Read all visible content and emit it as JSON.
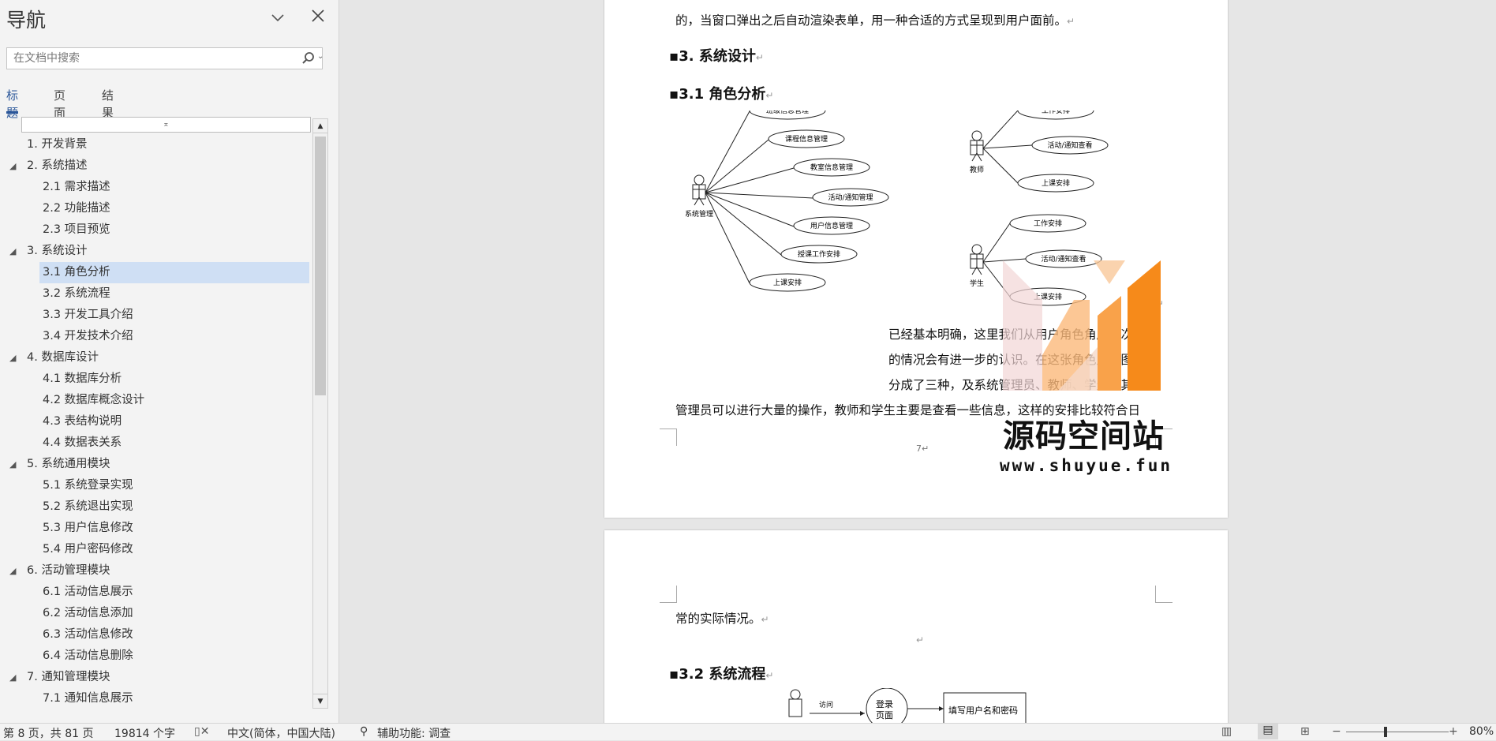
{
  "nav": {
    "title": "导航",
    "search_placeholder": "在文档中搜索",
    "tabs": [
      {
        "label": "标题",
        "active": true
      },
      {
        "label": "页面",
        "active": false
      },
      {
        "label": "结果",
        "active": false
      }
    ],
    "outline": [
      {
        "label": "1. 开发背景",
        "level": 1,
        "expandable": false,
        "selected": false
      },
      {
        "label": "2. 系统描述",
        "level": 1,
        "expandable": true,
        "selected": false
      },
      {
        "label": "2.1 需求描述",
        "level": 2,
        "expandable": false,
        "selected": false
      },
      {
        "label": "2.2 功能描述",
        "level": 2,
        "expandable": false,
        "selected": false
      },
      {
        "label": "2.3 项目预览",
        "level": 2,
        "expandable": false,
        "selected": false
      },
      {
        "label": "3. 系统设计",
        "level": 1,
        "expandable": true,
        "selected": false
      },
      {
        "label": "3.1 角色分析",
        "level": 2,
        "expandable": false,
        "selected": true
      },
      {
        "label": "3.2 系统流程",
        "level": 2,
        "expandable": false,
        "selected": false
      },
      {
        "label": "3.3 开发工具介绍",
        "level": 2,
        "expandable": false,
        "selected": false
      },
      {
        "label": "3.4 开发技术介绍",
        "level": 2,
        "expandable": false,
        "selected": false
      },
      {
        "label": "4. 数据库设计",
        "level": 1,
        "expandable": true,
        "selected": false
      },
      {
        "label": "4.1 数据库分析",
        "level": 2,
        "expandable": false,
        "selected": false
      },
      {
        "label": "4.2 数据库概念设计",
        "level": 2,
        "expandable": false,
        "selected": false
      },
      {
        "label": "4.3 表结构说明",
        "level": 2,
        "expandable": false,
        "selected": false
      },
      {
        "label": "4.4 数据表关系",
        "level": 2,
        "expandable": false,
        "selected": false
      },
      {
        "label": "5. 系统通用模块",
        "level": 1,
        "expandable": true,
        "selected": false
      },
      {
        "label": "5.1 系统登录实现",
        "level": 2,
        "expandable": false,
        "selected": false
      },
      {
        "label": "5.2 系统退出实现",
        "level": 2,
        "expandable": false,
        "selected": false
      },
      {
        "label": "5.3 用户信息修改",
        "level": 2,
        "expandable": false,
        "selected": false
      },
      {
        "label": "5.4 用户密码修改",
        "level": 2,
        "expandable": false,
        "selected": false
      },
      {
        "label": "6. 活动管理模块",
        "level": 1,
        "expandable": true,
        "selected": false
      },
      {
        "label": "6.1 活动信息展示",
        "level": 2,
        "expandable": false,
        "selected": false
      },
      {
        "label": "6.2 活动信息添加",
        "level": 2,
        "expandable": false,
        "selected": false
      },
      {
        "label": "6.3 活动信息修改",
        "level": 2,
        "expandable": false,
        "selected": false
      },
      {
        "label": "6.4 活动信息删除",
        "level": 2,
        "expandable": false,
        "selected": false
      },
      {
        "label": "7. 通知管理模块",
        "level": 1,
        "expandable": true,
        "selected": false
      },
      {
        "label": "7.1 通知信息展示",
        "level": 2,
        "expandable": false,
        "selected": false
      }
    ]
  },
  "document": {
    "page1": {
      "top_text": "的，当窗口弹出之后自动渲染表单，用一种合适的方式呈现到用户面前。",
      "heading3": "3.  系统设计",
      "heading31": "3.1  角色分析",
      "admin_actor": "系统管理",
      "admin_cases": [
        "班级信息管理",
        "课程信息管理",
        "教室信息管理",
        "活动/通知管理",
        "用户信息管理",
        "授课工作安排",
        "上课安排"
      ],
      "teacher_actor": "教师",
      "teacher_cases": [
        "工作安排",
        "活动/通知查看",
        "上课安排"
      ],
      "student_actor": "学生",
      "student_cases": [
        "工作安排",
        "活动/通知查看",
        "上课安排"
      ],
      "para_lines": [
        "已经基本明确，这里我们从用户角色角度再次",
        "的情况会有进一步的认识。在这张角色用例图",
        "分成了三种，及系统管理员、教师、学生，其中",
        "管理员可以进行大量的操作，教师和学生主要是查看一些信息，这样的安排比较符合日"
      ],
      "page_number": "7"
    },
    "page2": {
      "first_text": "常的实际情况。",
      "heading32": "3.2  系统流程",
      "flow_access": "访问",
      "flow_login_l1": "登录",
      "flow_login_l2": "页面",
      "flow_box": "填写用户名和密码"
    },
    "watermark": {
      "name": "源码空间站",
      "url": "www.shuyue.fun"
    }
  },
  "status": {
    "page": "第 8 页，共 81 页",
    "words": "19814 个字",
    "language": "中文(简体，中国大陆)",
    "accessibility": "辅助功能: 调查",
    "zoom": "80%"
  }
}
